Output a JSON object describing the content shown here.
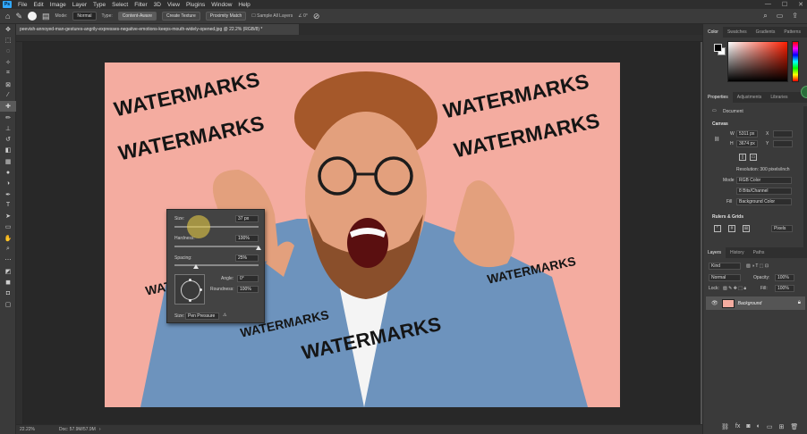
{
  "app": {
    "logo_text": "Ps",
    "menu": [
      "File",
      "Edit",
      "Image",
      "Layer",
      "Type",
      "Select",
      "Filter",
      "3D",
      "View",
      "Plugins",
      "Window",
      "Help"
    ],
    "window_controls": [
      "—",
      "☐",
      "✕"
    ]
  },
  "options": {
    "mode_label": "Mode:",
    "mode_value": "Normal",
    "type_label": "Type:",
    "type_buttons": [
      "Content-Aware",
      "Create Texture",
      "Proximity Match"
    ],
    "sample_all_label": "Sample All Layers",
    "angle_value": "0°"
  },
  "document": {
    "tab_title": "peevish-annoyed-man-gestures-angrily-expresses-negative-emotions-keeps-mouth-widely-opened.jpg @ 22.2% (RGB/8) *",
    "zoom": "22.22%",
    "doc_info": "Doc: 57.9M/57.9M"
  },
  "watermarks": {
    "text": "WATERMARKS",
    "partial_left": "WAT",
    "partial_mid": "WATERMARKS"
  },
  "brush_panel": {
    "size_label": "Size:",
    "size_value": "37 px",
    "hardness_label": "Hardness:",
    "hardness_value": "100%",
    "spacing_label": "Spacing:",
    "spacing_value": "25%",
    "angle_label": "Angle:",
    "angle_value": "0°",
    "roundness_label": "Roundness:",
    "roundness_value": "100%",
    "pressure_label": "Size:",
    "pressure_value": "Pen Pressure",
    "hardness_level": 1.0,
    "spacing_level": 0.25
  },
  "right_panel": {
    "color_tabs": [
      "Color",
      "Swatches",
      "Gradients",
      "Patterns"
    ],
    "prop_tabs": [
      "Properties",
      "Adjustments",
      "Libraries"
    ],
    "document_label": "Document",
    "canvas_title": "Canvas",
    "width_label": "W",
    "width_value": "5311 px",
    "height_label": "H",
    "height_value": "3674 px",
    "x_label": "X",
    "y_label": "Y",
    "resolution": "Resolution: 300 pixels/inch",
    "mode_label": "Mode",
    "mode_value": "RGB Color",
    "depth_value": "8 Bits/Channel",
    "fill_label": "Fill",
    "fill_value": "Background Color",
    "rulers_title": "Rulers & Grids",
    "units_value": "Pixels",
    "layer_tabs": [
      "Layers",
      "History",
      "Paths"
    ],
    "kind_value": "Kind",
    "blend_value": "Normal",
    "opacity_label": "Opacity:",
    "opacity_value": "100%",
    "lock_label": "Lock:",
    "fill_pct_label": "Fill:",
    "fill_pct_value": "100%",
    "layer_name": "Background"
  },
  "colors": {
    "canvas_bg": "#f4aca0",
    "accent": "#31a8ff"
  }
}
